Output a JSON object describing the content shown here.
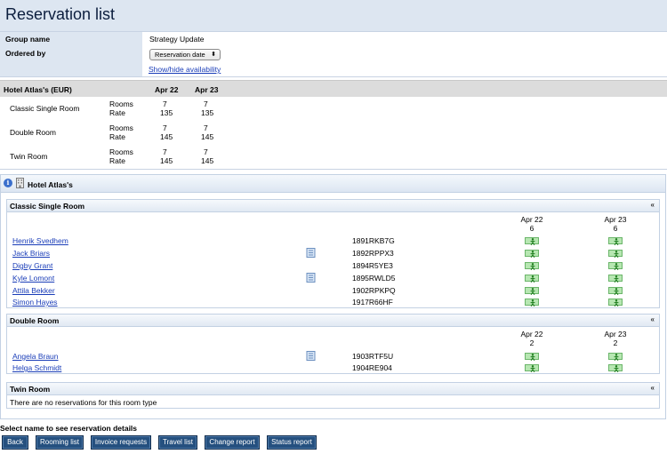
{
  "page": {
    "title": "Reservation list"
  },
  "info": {
    "group_label": "Group name",
    "group_value": "Strategy Update",
    "order_label": "Ordered by",
    "order_selected": "Reservation date",
    "toggle_link": "Show/hide availability"
  },
  "rates": {
    "hotel_header": "Hotel Atlas's  (EUR)",
    "dates": [
      "Apr 22",
      "Apr 23"
    ],
    "rooms_label": "Rooms",
    "rate_label": "Rate",
    "rows": [
      {
        "name": "Classic Single Room",
        "rooms": [
          "7",
          "7"
        ],
        "rate": [
          "135",
          "135"
        ]
      },
      {
        "name": "Double Room",
        "rooms": [
          "7",
          "7"
        ],
        "rate": [
          "145",
          "145"
        ]
      },
      {
        "name": "Twin Room",
        "rooms": [
          "7",
          "7"
        ],
        "rate": [
          "145",
          "145"
        ]
      }
    ]
  },
  "reservations": {
    "hotel_name": "Hotel Atlas's",
    "collapse_glyph": "«",
    "room_types": [
      {
        "name": "Classic Single Room",
        "dates": [
          "Apr 22",
          "Apr 23"
        ],
        "counts": [
          "6",
          "6"
        ],
        "guests": [
          {
            "name": "Henrik Svedhem",
            "code": "1891RKB7G",
            "has_doc": false
          },
          {
            "name": "Jack Briars",
            "code": "1892RPPX3",
            "has_doc": true
          },
          {
            "name": "Digby Grant",
            "code": "1894R5YE3",
            "has_doc": false
          },
          {
            "name": "Kyle Lomont",
            "code": "1895RWLD5",
            "has_doc": true
          },
          {
            "name": "Attila Bekker",
            "code": "1902RPKPQ",
            "has_doc": false
          },
          {
            "name": "Simon Hayes",
            "code": "1917R66HF",
            "has_doc": false
          }
        ]
      },
      {
        "name": "Double Room",
        "dates": [
          "Apr 22",
          "Apr 23"
        ],
        "counts": [
          "2",
          "2"
        ],
        "guests": [
          {
            "name": "Angela Braun",
            "code": "1903RTF5U",
            "has_doc": true
          },
          {
            "name": "Helga Schmidt",
            "code": "1904RE904",
            "has_doc": false
          }
        ]
      },
      {
        "name": "Twin Room",
        "empty_message": "There are no reservations for this room type"
      }
    ]
  },
  "footer": {
    "instruction": "Select name to see reservation details",
    "buttons": [
      "Back",
      "Rooming list",
      "Invoice requests",
      "Travel list",
      "Change report",
      "Status report"
    ]
  },
  "colors": {
    "title_bg": "#dde6f1",
    "button_bg": "#25507f",
    "link": "#1a3db8",
    "availability": "#b7e7b2"
  }
}
